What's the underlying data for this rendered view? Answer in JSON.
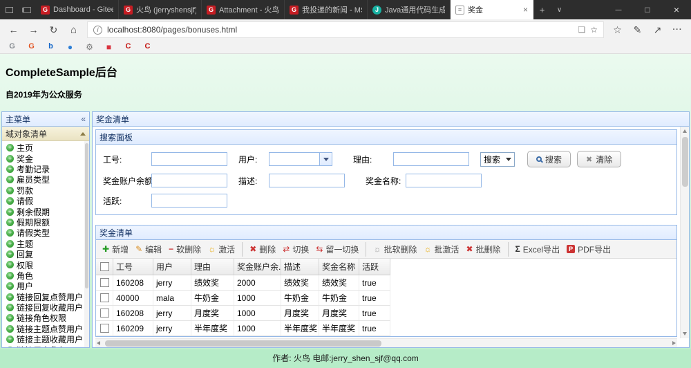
{
  "colors": {
    "panel_border": "#95B8E7",
    "panel_title": "#0E2D5F",
    "page_bg_top": "#ebfaef",
    "page_bg_bottom": "#bceecd",
    "footer_bg": "#b6ecc8",
    "titlebar_bg": "#2d2d2d",
    "chrome_bg": "#f2f2f2",
    "gitee_red": "#c71d23"
  },
  "browser": {
    "tabs": [
      {
        "icon": "gitee",
        "title": "Dashboard - Gitee",
        "active": false
      },
      {
        "icon": "gitee",
        "title": "火鸟 (jerryshensjf) - Git",
        "active": false
      },
      {
        "icon": "gitee",
        "title": "Attachment - 火鸟(第三",
        "active": false
      },
      {
        "icon": "gitee",
        "title": "我投递的新闻 - MS&A(",
        "active": false
      },
      {
        "icon": "java",
        "title": "Java通用代码生成器光",
        "active": false
      },
      {
        "icon": "page",
        "title": "奖金",
        "active": true
      }
    ],
    "url": "localhost:8080/pages/bonuses.html",
    "bookmarks": [
      {
        "icon": "g-gray"
      },
      {
        "icon": "g-orange"
      },
      {
        "icon": "b-blue"
      },
      {
        "icon": "ball-blue"
      },
      {
        "icon": "gear-gray"
      },
      {
        "icon": "tile-red"
      },
      {
        "icon": "c-red"
      },
      {
        "icon": "c-red"
      }
    ]
  },
  "page": {
    "title": "CompleteSample后台",
    "subtitle": "自2019年为公众服务",
    "footer": "作者: 火鸟 电邮:jerry_shen_sjf@qq.com"
  },
  "sidebar": {
    "panel_title": "主菜单",
    "accordion_title": "域对象清单",
    "items": [
      "主页",
      "奖金",
      "考勤记录",
      "雇员类型",
      "罚款",
      "请假",
      "剩余假期",
      "假期限额",
      "请假类型",
      "主题",
      "回复",
      "权限",
      "角色",
      "用户",
      "链接回复点赞用户",
      "链接回复收藏用户",
      "链接角色权限",
      "链接主题点赞用户",
      "链接主题收藏用户",
      "链接用户角色"
    ]
  },
  "main": {
    "panel_title": "奖金清单",
    "search": {
      "title": "搜索面板",
      "empno_label": "工号:",
      "user_label": "用户:",
      "reason_label": "理由:",
      "balance_label": "奖金账户余额:",
      "desc_label": "描述:",
      "name_label": "奖金名称:",
      "active_label": "活跃:",
      "empno_value": "",
      "user_value": "",
      "reason_value": "",
      "balance_value": "",
      "desc_value": "",
      "name_value": "",
      "active_value": "",
      "mode_value": "搜索",
      "search_button": "搜索",
      "clear_button": "清除"
    },
    "grid": {
      "title": "奖金清单",
      "toolbar": [
        {
          "icon": "add",
          "label": "新增",
          "sep": false
        },
        {
          "icon": "edit",
          "label": "编辑",
          "sep": false
        },
        {
          "icon": "softdelete",
          "label": "软删除",
          "sep": false
        },
        {
          "icon": "activate",
          "label": "激活",
          "sep": false
        },
        {
          "icon": "delete",
          "label": "删除",
          "sep": true
        },
        {
          "icon": "toggle",
          "label": "切换",
          "sep": false
        },
        {
          "icon": "toggle-one",
          "label": "留一切换",
          "sep": false
        },
        {
          "icon": "batch-softdelete",
          "label": "批软删除",
          "sep": true
        },
        {
          "icon": "batch-activate",
          "label": "批激活",
          "sep": false
        },
        {
          "icon": "batch-delete",
          "label": "批删除",
          "sep": false
        },
        {
          "icon": "sigma",
          "label": "Excel导出",
          "sep": true
        },
        {
          "icon": "pdf",
          "label": "PDF导出",
          "sep": false
        }
      ],
      "columns": [
        {
          "key": "empno",
          "label": "工号"
        },
        {
          "key": "user",
          "label": "用户"
        },
        {
          "key": "reason",
          "label": "理由"
        },
        {
          "key": "balance",
          "label": "奖金账户余..."
        },
        {
          "key": "desc",
          "label": "描述"
        },
        {
          "key": "name",
          "label": "奖金名称"
        },
        {
          "key": "active",
          "label": "活跃"
        }
      ],
      "rows": [
        {
          "empno": "160208",
          "user": "jerry",
          "reason": "绩效奖",
          "balance": "2000",
          "desc": "绩效奖",
          "name": "绩效奖",
          "active": "true"
        },
        {
          "empno": "40000",
          "user": "mala",
          "reason": "牛奶金",
          "balance": "1000",
          "desc": "牛奶金",
          "name": "牛奶金",
          "active": "true"
        },
        {
          "empno": "160208",
          "user": "jerry",
          "reason": "月度奖",
          "balance": "1000",
          "desc": "月度奖",
          "name": "月度奖",
          "active": "true"
        },
        {
          "empno": "160209",
          "user": "jerry",
          "reason": "半年度奖",
          "balance": "1000",
          "desc": "半年度奖",
          "name": "半年度奖",
          "active": "true"
        }
      ]
    }
  }
}
